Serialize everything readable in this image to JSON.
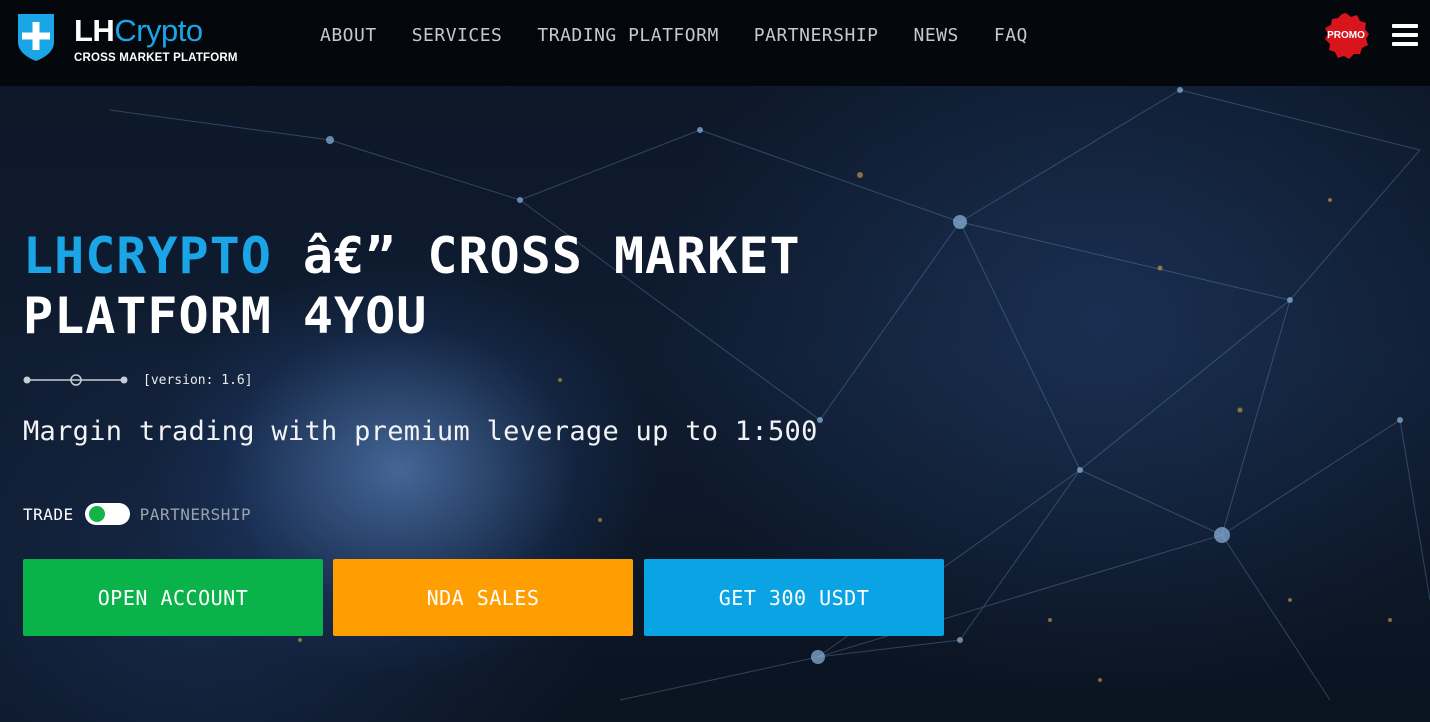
{
  "logo": {
    "brand_part1": "LH",
    "brand_part2": "Crypto",
    "tagline": "CROSS MARKET PLATFORM",
    "icon": "shield-plus-icon"
  },
  "nav": {
    "items": [
      {
        "label": "ABOUT"
      },
      {
        "label": "SERVICES"
      },
      {
        "label": "TRADING PLATFORM"
      },
      {
        "label": "PARTNERSHIP"
      },
      {
        "label": "NEWS"
      },
      {
        "label": "FAQ"
      }
    ]
  },
  "header_right": {
    "promo_label": "PROMO",
    "menu_icon": "hamburger-icon"
  },
  "hero": {
    "title_accent": "LHCRYPTO",
    "title_rest": " â€” CROSS MARKET PLATFORM 4YOU",
    "version": "[version: 1.6]",
    "subtitle": "Margin trading with premium leverage up to 1:500"
  },
  "toggle": {
    "left_label": "TRADE",
    "right_label": "PARTNERSHIP"
  },
  "buttons": {
    "open_account": "OPEN ACCOUNT",
    "nda_sales": "NDA SALES",
    "get_usdt": "GET 300 USDT"
  },
  "colors": {
    "accent_blue": "#1aa6e6",
    "green": "#0ab24a",
    "orange": "#ff9e00",
    "blue_button": "#0aa3e3",
    "promo_red": "#d8141c"
  }
}
